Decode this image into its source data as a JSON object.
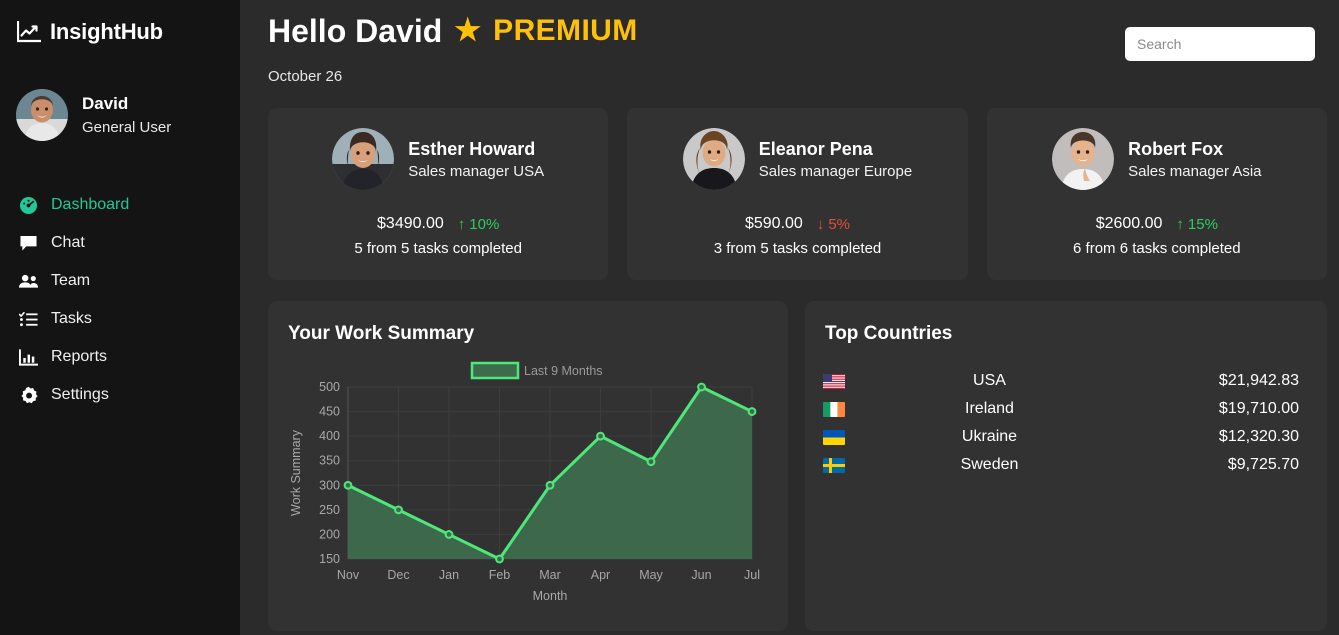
{
  "sidebar": {
    "brand": {
      "name": "InsightHub",
      "logo_icon": "chart-line-up-icon"
    },
    "user": {
      "name": "David",
      "role": "General User",
      "avatar_icon": "user-avatar"
    },
    "items": [
      {
        "label": "Dashboard",
        "icon": "gauge-icon",
        "active": true
      },
      {
        "label": "Chat",
        "icon": "chat-bubble-icon",
        "active": false
      },
      {
        "label": "Team",
        "icon": "people-icon",
        "active": false
      },
      {
        "label": "Tasks",
        "icon": "task-list-icon",
        "active": false
      },
      {
        "label": "Reports",
        "icon": "bar-chart-icon",
        "active": false
      },
      {
        "label": "Settings",
        "icon": "gear-icon",
        "active": false
      }
    ]
  },
  "header": {
    "greeting": "Hello David",
    "star_icon": "star-icon",
    "badge": "PREMIUM",
    "date": "October 26",
    "search_placeholder": "Search",
    "search_value": ""
  },
  "cards": [
    {
      "name": "Esther Howard",
      "role": "Sales manager USA",
      "amount": "$3490.00",
      "delta": "10%",
      "direction": "up",
      "arrow": "↑",
      "tasks": "5 from 5 tasks completed"
    },
    {
      "name": "Eleanor Pena",
      "role": "Sales manager Europe",
      "amount": "$590.00",
      "delta": "5%",
      "direction": "down",
      "arrow": "↓",
      "tasks": "3 from 5 tasks completed"
    },
    {
      "name": "Robert Fox",
      "role": "Sales manager Asia",
      "amount": "$2600.00",
      "delta": "15%",
      "direction": "up",
      "arrow": "↑",
      "tasks": "6 from 6 tasks completed"
    }
  ],
  "work_summary": {
    "title": "Your Work Summary"
  },
  "chart_data": {
    "type": "area",
    "title": "",
    "legend": [
      "Last 9 Months"
    ],
    "legend_position": "top-center",
    "xlabel": "Month",
    "ylabel": "Work Summary",
    "categories": [
      "Nov",
      "Dec",
      "Jan",
      "Feb",
      "Mar",
      "Apr",
      "May",
      "Jun",
      "Jul"
    ],
    "values": [
      300,
      250,
      200,
      150,
      300,
      400,
      348,
      500,
      450
    ],
    "ylim": [
      150,
      500
    ],
    "yticks": [
      150,
      200,
      250,
      300,
      350,
      400,
      450,
      500
    ],
    "grid": true,
    "line_color": "#4ee87a",
    "fill_color": "#3f6b4d",
    "series": [
      {
        "name": "Last 9 Months",
        "values": [
          300,
          250,
          200,
          150,
          300,
          400,
          348,
          500,
          450
        ]
      }
    ]
  },
  "top_countries": {
    "title": "Top Countries",
    "rows": [
      {
        "flag": "flag-usa",
        "name": "USA",
        "value": "$21,942.83"
      },
      {
        "flag": "flag-ireland",
        "name": "Ireland",
        "value": "$19,710.00"
      },
      {
        "flag": "flag-ukraine",
        "name": "Ukraine",
        "value": "$12,320.30"
      },
      {
        "flag": "flag-sweden",
        "name": "Sweden",
        "value": "$9,725.70"
      }
    ]
  },
  "colors": {
    "sidebar_bg": "#141414",
    "main_bg": "#2b2b2b",
    "panel_bg": "#323232",
    "accent_teal": "#20c997",
    "accent_gold": "#ffc107",
    "up_green": "#2ecc5f",
    "down_red": "#e74c3c",
    "chart_line": "#4ee87a"
  }
}
